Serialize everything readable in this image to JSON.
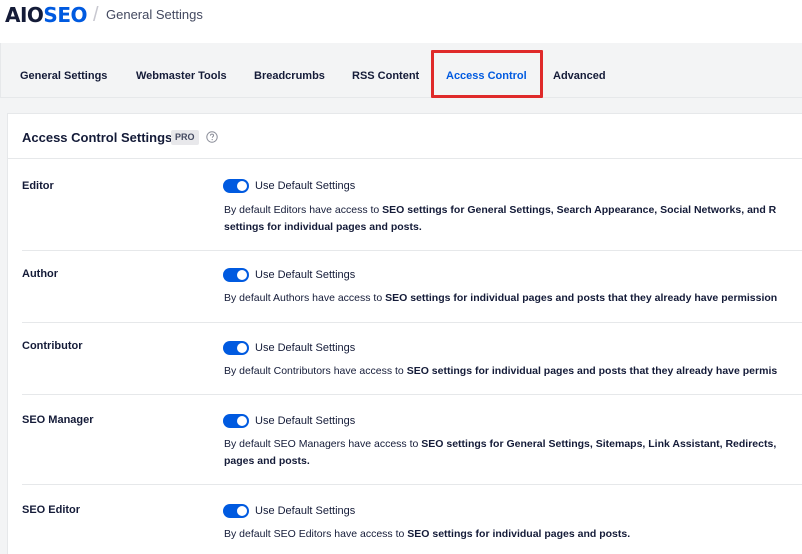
{
  "header": {
    "logo_prefix": "AIO",
    "logo_suffix": "SEO",
    "breadcrumb_separator": "/",
    "breadcrumb": "General Settings"
  },
  "tabs": [
    {
      "label": "General Settings"
    },
    {
      "label": "Webmaster Tools"
    },
    {
      "label": "Breadcrumbs"
    },
    {
      "label": "RSS Content"
    },
    {
      "label": "Access Control",
      "active": true
    },
    {
      "label": "Advanced"
    }
  ],
  "card": {
    "title": "Access Control Settings",
    "badge": "PRO",
    "help_icon": "question-circle-icon"
  },
  "roles": [
    {
      "name": "Editor",
      "toggle_label": "Use Default Settings",
      "toggle_on": true,
      "desc_prefix": "By default Editors have access to ",
      "desc_bold_1": "SEO settings for General Settings, Search Appearance, Social Networks, and R",
      "desc_bold_2": "settings for individual pages and posts."
    },
    {
      "name": "Author",
      "toggle_label": "Use Default Settings",
      "toggle_on": true,
      "desc_prefix": "By default Authors have access to ",
      "desc_bold_1": "SEO settings for individual pages and posts that they already have permission"
    },
    {
      "name": "Contributor",
      "toggle_label": "Use Default Settings",
      "toggle_on": true,
      "desc_prefix": "By default Contributors have access to ",
      "desc_bold_1": "SEO settings for individual pages and posts that they already have permis"
    },
    {
      "name": "SEO Manager",
      "toggle_label": "Use Default Settings",
      "toggle_on": true,
      "desc_prefix": "By default SEO Managers have access to ",
      "desc_bold_1": "SEO settings for General Settings, Sitemaps, Link Assistant, Redirects,",
      "desc_bold_2": "pages and posts."
    },
    {
      "name": "SEO Editor",
      "toggle_label": "Use Default Settings",
      "toggle_on": true,
      "desc_prefix": "By default SEO Editors have access to ",
      "desc_bold_1": "SEO settings for individual pages and posts."
    }
  ],
  "colors": {
    "accent": "#005ae0",
    "highlight": "#df2a2a",
    "text": "#141b38"
  }
}
